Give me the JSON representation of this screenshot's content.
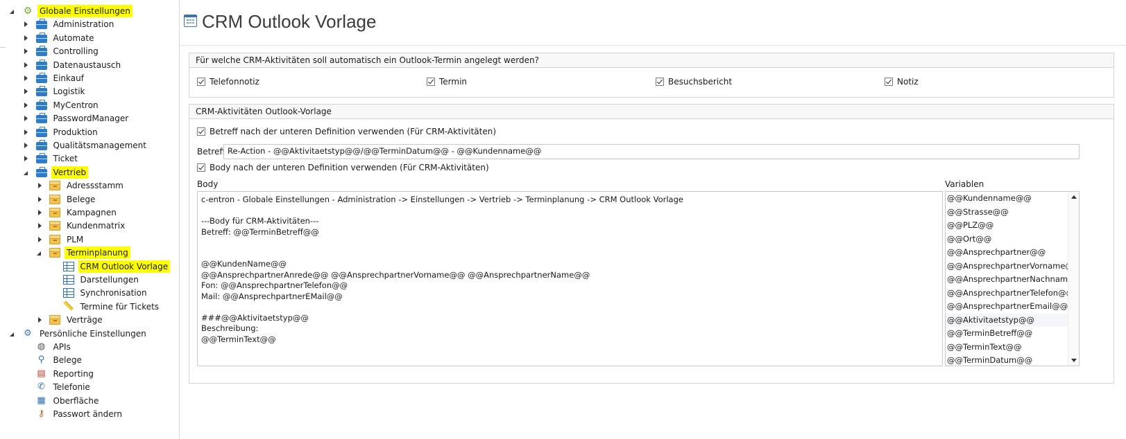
{
  "sidebar": {
    "items": [
      {
        "label": "Globale Einstellungen",
        "state": "expanded",
        "icon": "gears-icon",
        "highlight": true
      },
      {
        "label": "Administration",
        "state": "collapsed",
        "icon": "briefcase-icon"
      },
      {
        "label": "Automate",
        "state": "collapsed",
        "icon": "briefcase-icon"
      },
      {
        "label": "Controlling",
        "state": "collapsed",
        "icon": "briefcase-icon"
      },
      {
        "label": "Datenaustausch",
        "state": "collapsed",
        "icon": "briefcase-icon"
      },
      {
        "label": "Einkauf",
        "state": "collapsed",
        "icon": "briefcase-icon"
      },
      {
        "label": "Logistik",
        "state": "collapsed",
        "icon": "briefcase-icon"
      },
      {
        "label": "MyCentron",
        "state": "collapsed",
        "icon": "briefcase-icon"
      },
      {
        "label": "PasswordManager",
        "state": "collapsed",
        "icon": "briefcase-icon"
      },
      {
        "label": "Produktion",
        "state": "collapsed",
        "icon": "briefcase-icon"
      },
      {
        "label": "Qualitätsmanagement",
        "state": "collapsed",
        "icon": "briefcase-icon"
      },
      {
        "label": "Ticket",
        "state": "collapsed",
        "icon": "briefcase-icon"
      },
      {
        "label": "Vertrieb",
        "state": "expanded",
        "icon": "briefcase-icon",
        "highlight": true
      },
      {
        "label": "Adressstamm",
        "state": "collapsed",
        "icon": "folder-icon"
      },
      {
        "label": "Belege",
        "state": "collapsed",
        "icon": "folder-icon"
      },
      {
        "label": "Kampagnen",
        "state": "collapsed",
        "icon": "folder-icon"
      },
      {
        "label": "Kundenmatrix",
        "state": "collapsed",
        "icon": "folder-icon"
      },
      {
        "label": "PLM",
        "state": "collapsed",
        "icon": "folder-icon"
      },
      {
        "label": "Terminplanung",
        "state": "expanded",
        "icon": "folder-icon",
        "highlight": true
      },
      {
        "label": "CRM Outlook Vorlage",
        "state": "leaf",
        "icon": "grid-icon",
        "highlight": true
      },
      {
        "label": "Darstellungen",
        "state": "leaf",
        "icon": "grid-icon"
      },
      {
        "label": "Synchronisation",
        "state": "leaf",
        "icon": "grid-icon"
      },
      {
        "label": "Termine für Tickets",
        "state": "leaf",
        "icon": "ruler-icon"
      },
      {
        "label": "Verträge",
        "state": "collapsed",
        "icon": "folder-icon"
      },
      {
        "label": "Persönliche Einstellungen",
        "state": "expanded",
        "icon": "person-settings-icon"
      },
      {
        "label": "APIs",
        "state": "leaf",
        "icon": "globe-icon"
      },
      {
        "label": "Belege",
        "state": "leaf",
        "icon": "magnifier-icon"
      },
      {
        "label": "Reporting",
        "state": "leaf",
        "icon": "pdf-icon"
      },
      {
        "label": "Telefonie",
        "state": "leaf",
        "icon": "phone-icon"
      },
      {
        "label": "Oberfläche",
        "state": "leaf",
        "icon": "layout-icon"
      },
      {
        "label": "Passwort ändern",
        "state": "leaf",
        "icon": "user-key-icon"
      }
    ]
  },
  "header": {
    "title": "CRM Outlook Vorlage"
  },
  "activities_group": {
    "title": "Für welche CRM-Aktivitäten soll automatisch ein Outlook-Termin angelegt werden?",
    "options": [
      {
        "label": "Telefonnotiz",
        "checked": true
      },
      {
        "label": "Termin",
        "checked": true
      },
      {
        "label": "Besuchsbericht",
        "checked": true
      },
      {
        "label": "Notiz",
        "checked": true
      }
    ]
  },
  "template_group": {
    "title": "CRM-Aktivitäten Outlook-Vorlage",
    "subject_checkbox": {
      "label": "Betreff nach der unteren Definition verwenden (Für CRM-Aktivitäten)",
      "checked": true
    },
    "subject_label": "Betreff",
    "subject_value": "Re-Action - @@Aktivitaetstyp@@/@@TerminDatum@@ - @@Kundenname@@",
    "body_checkbox": {
      "label": "Body nach der unteren Definition verwenden (Für CRM-Aktivitäten)",
      "checked": true
    },
    "body_label": "Body",
    "body_value": "c-entron - Globale Einstellungen - Administration -> Einstellungen -> Vertrieb -> Terminplanung -> CRM Outlook Vorlage\n\n---Body für CRM-Aktivitäten---\nBetreff: @@TerminBetreff@@\n\n\n@@KundenName@@\n@@AnsprechpartnerAnrede@@ @@AnsprechpartnerVorname@@ @@AnsprechpartnerName@@\nFon: @@AnsprechpartnerTelefon@@\nMail: @@AnsprechpartnerEMail@@\n\n###@@Aktivitaetstyp@@\nBeschreibung:\n@@TerminText@@",
    "variables_label": "Variablen",
    "variables": [
      "@@Kundenname@@",
      "@@Strasse@@",
      "@@PLZ@@",
      "@@Ort@@",
      "@@Ansprechpartner@@",
      "@@AnsprechpartnerVorname@@",
      "@@AnsprechpartnerNachname@@",
      "@@AnsprechpartnerTelefon@@",
      "@@AnsprechpartnerEmail@@",
      "@@Aktivitaetstyp@@",
      "@@TerminBetreff@@",
      "@@TerminText@@",
      "@@TerminDatum@@"
    ],
    "selected_variable_index": 9
  },
  "colors": {
    "highlight": "#ffff00",
    "briefcase": "#2e7bc8",
    "folder": "#f3c14d",
    "gear": "#74b02a"
  }
}
